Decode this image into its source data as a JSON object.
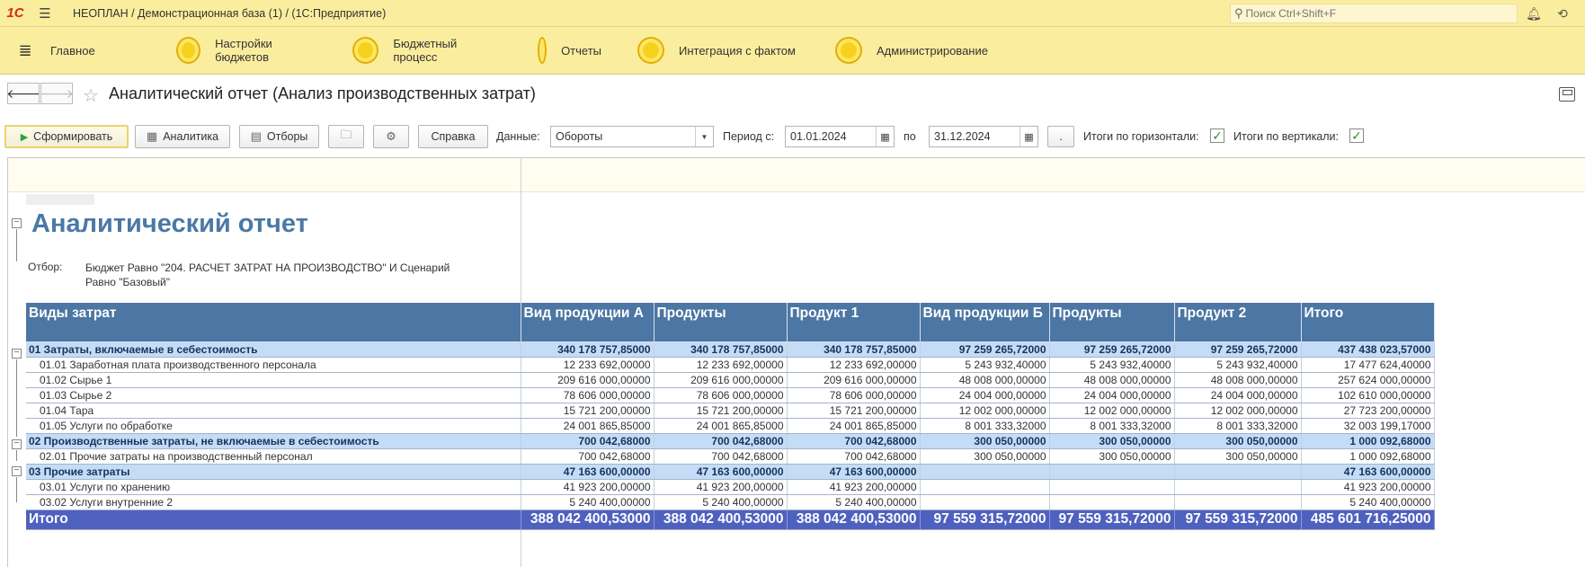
{
  "app": {
    "logo_text": "1С",
    "title": "НЕОПЛАН / Демонстрационная база (1) /  (1С:Предприятие)",
    "search_placeholder": "Поиск Ctrl+Shift+F"
  },
  "sections": [
    {
      "label": "Главное"
    },
    {
      "label": "Настройки бюджетов"
    },
    {
      "label": "Бюджетный процесс"
    },
    {
      "label": "Отчеты"
    },
    {
      "label": "Интеграция с фактом"
    },
    {
      "label": "Администрирование"
    }
  ],
  "form": {
    "title": "Аналитический отчет (Анализ производственных затрат)",
    "back_icon": "back-arrow-icon",
    "forward_icon": "forward-arrow-icon"
  },
  "toolbar": {
    "generate": "Сформировать",
    "analytics": "Аналитика",
    "filters": "Отборы",
    "help": "Справка",
    "data_label": "Данные:",
    "data_value": "Обороты",
    "period_from_label": "Период с:",
    "period_from": "01.01.2024",
    "period_to_label": "по",
    "period_to": "31.12.2024",
    "period_btn": ".",
    "totals_h_label": "Итоги по горизонтали:",
    "totals_v_label": "Итоги по вертикали:",
    "totals_h_checked": true,
    "totals_v_checked": true
  },
  "report": {
    "title": "Аналитический отчет",
    "filter_label": "Отбор:",
    "filter_text": "Бюджет Равно \"204. РАСЧЕТ ЗАТРАТ НА ПРОИЗВОДСТВО\" И Сценарий Равно \"Базовый\"",
    "columns": [
      "Виды затрат",
      "Вид продукции А",
      "Продукты",
      "Продукт 1",
      "Вид продукции Б",
      "Продукты",
      "Продукт 2",
      "Итого"
    ],
    "rows": [
      {
        "type": "group",
        "cells": [
          "01 Затраты, включаемые в себестоимость",
          "340 178 757,85000",
          "340 178 757,85000",
          "340 178 757,85000",
          "97 259 265,72000",
          "97 259 265,72000",
          "97 259 265,72000",
          "437 438 023,57000"
        ]
      },
      {
        "type": "item",
        "cells": [
          "01.01 Заработная плата производственного персонала",
          "12 233 692,00000",
          "12 233 692,00000",
          "12 233 692,00000",
          "5 243 932,40000",
          "5 243 932,40000",
          "5 243 932,40000",
          "17 477 624,40000"
        ]
      },
      {
        "type": "item",
        "cells": [
          "01.02 Сырье 1",
          "209 616 000,00000",
          "209 616 000,00000",
          "209 616 000,00000",
          "48 008 000,00000",
          "48 008 000,00000",
          "48 008 000,00000",
          "257 624 000,00000"
        ]
      },
      {
        "type": "item",
        "cells": [
          "01.03 Сырье 2",
          "78 606 000,00000",
          "78 606 000,00000",
          "78 606 000,00000",
          "24 004 000,00000",
          "24 004 000,00000",
          "24 004 000,00000",
          "102 610 000,00000"
        ]
      },
      {
        "type": "item",
        "cells": [
          "01.04 Тара",
          "15 721 200,00000",
          "15 721 200,00000",
          "15 721 200,00000",
          "12 002 000,00000",
          "12 002 000,00000",
          "12 002 000,00000",
          "27 723 200,00000"
        ]
      },
      {
        "type": "item",
        "cells": [
          "01.05 Услуги по обработке",
          "24 001 865,85000",
          "24 001 865,85000",
          "24 001 865,85000",
          "8 001 333,32000",
          "8 001 333,32000",
          "8 001 333,32000",
          "32 003 199,17000"
        ]
      },
      {
        "type": "group",
        "cells": [
          "02 Производственные затраты, не включаемые в себестоимость",
          "700 042,68000",
          "700 042,68000",
          "700 042,68000",
          "300 050,00000",
          "300 050,00000",
          "300 050,00000",
          "1 000 092,68000"
        ]
      },
      {
        "type": "item",
        "cells": [
          "02.01 Прочие затраты на производственный персонал",
          "700 042,68000",
          "700 042,68000",
          "700 042,68000",
          "300 050,00000",
          "300 050,00000",
          "300 050,00000",
          "1 000 092,68000"
        ]
      },
      {
        "type": "group",
        "cells": [
          "03 Прочие затраты",
          "47 163 600,00000",
          "47 163 600,00000",
          "47 163 600,00000",
          "",
          "",
          "",
          "47 163 600,00000"
        ]
      },
      {
        "type": "item",
        "cells": [
          "03.01 Услуги по хранению",
          "41 923 200,00000",
          "41 923 200,00000",
          "41 923 200,00000",
          "",
          "",
          "",
          "41 923 200,00000"
        ]
      },
      {
        "type": "item",
        "cells": [
          "03.02 Услуги внутренние 2",
          "5 240 400,00000",
          "5 240 400,00000",
          "5 240 400,00000",
          "",
          "",
          "",
          "5 240 400,00000"
        ]
      },
      {
        "type": "total",
        "cells": [
          "Итого",
          "388 042 400,53000",
          "388 042 400,53000",
          "388 042 400,53000",
          "97 559 315,72000",
          "97 559 315,72000",
          "97 559 315,72000",
          "485 601 716,25000"
        ]
      }
    ]
  },
  "colors": {
    "header_bg": "#fbed9e",
    "table_header": "#4c76a3",
    "group_row": "#c5dcf7",
    "total_row": "#4f61bf",
    "report_title": "#4b78a6"
  }
}
